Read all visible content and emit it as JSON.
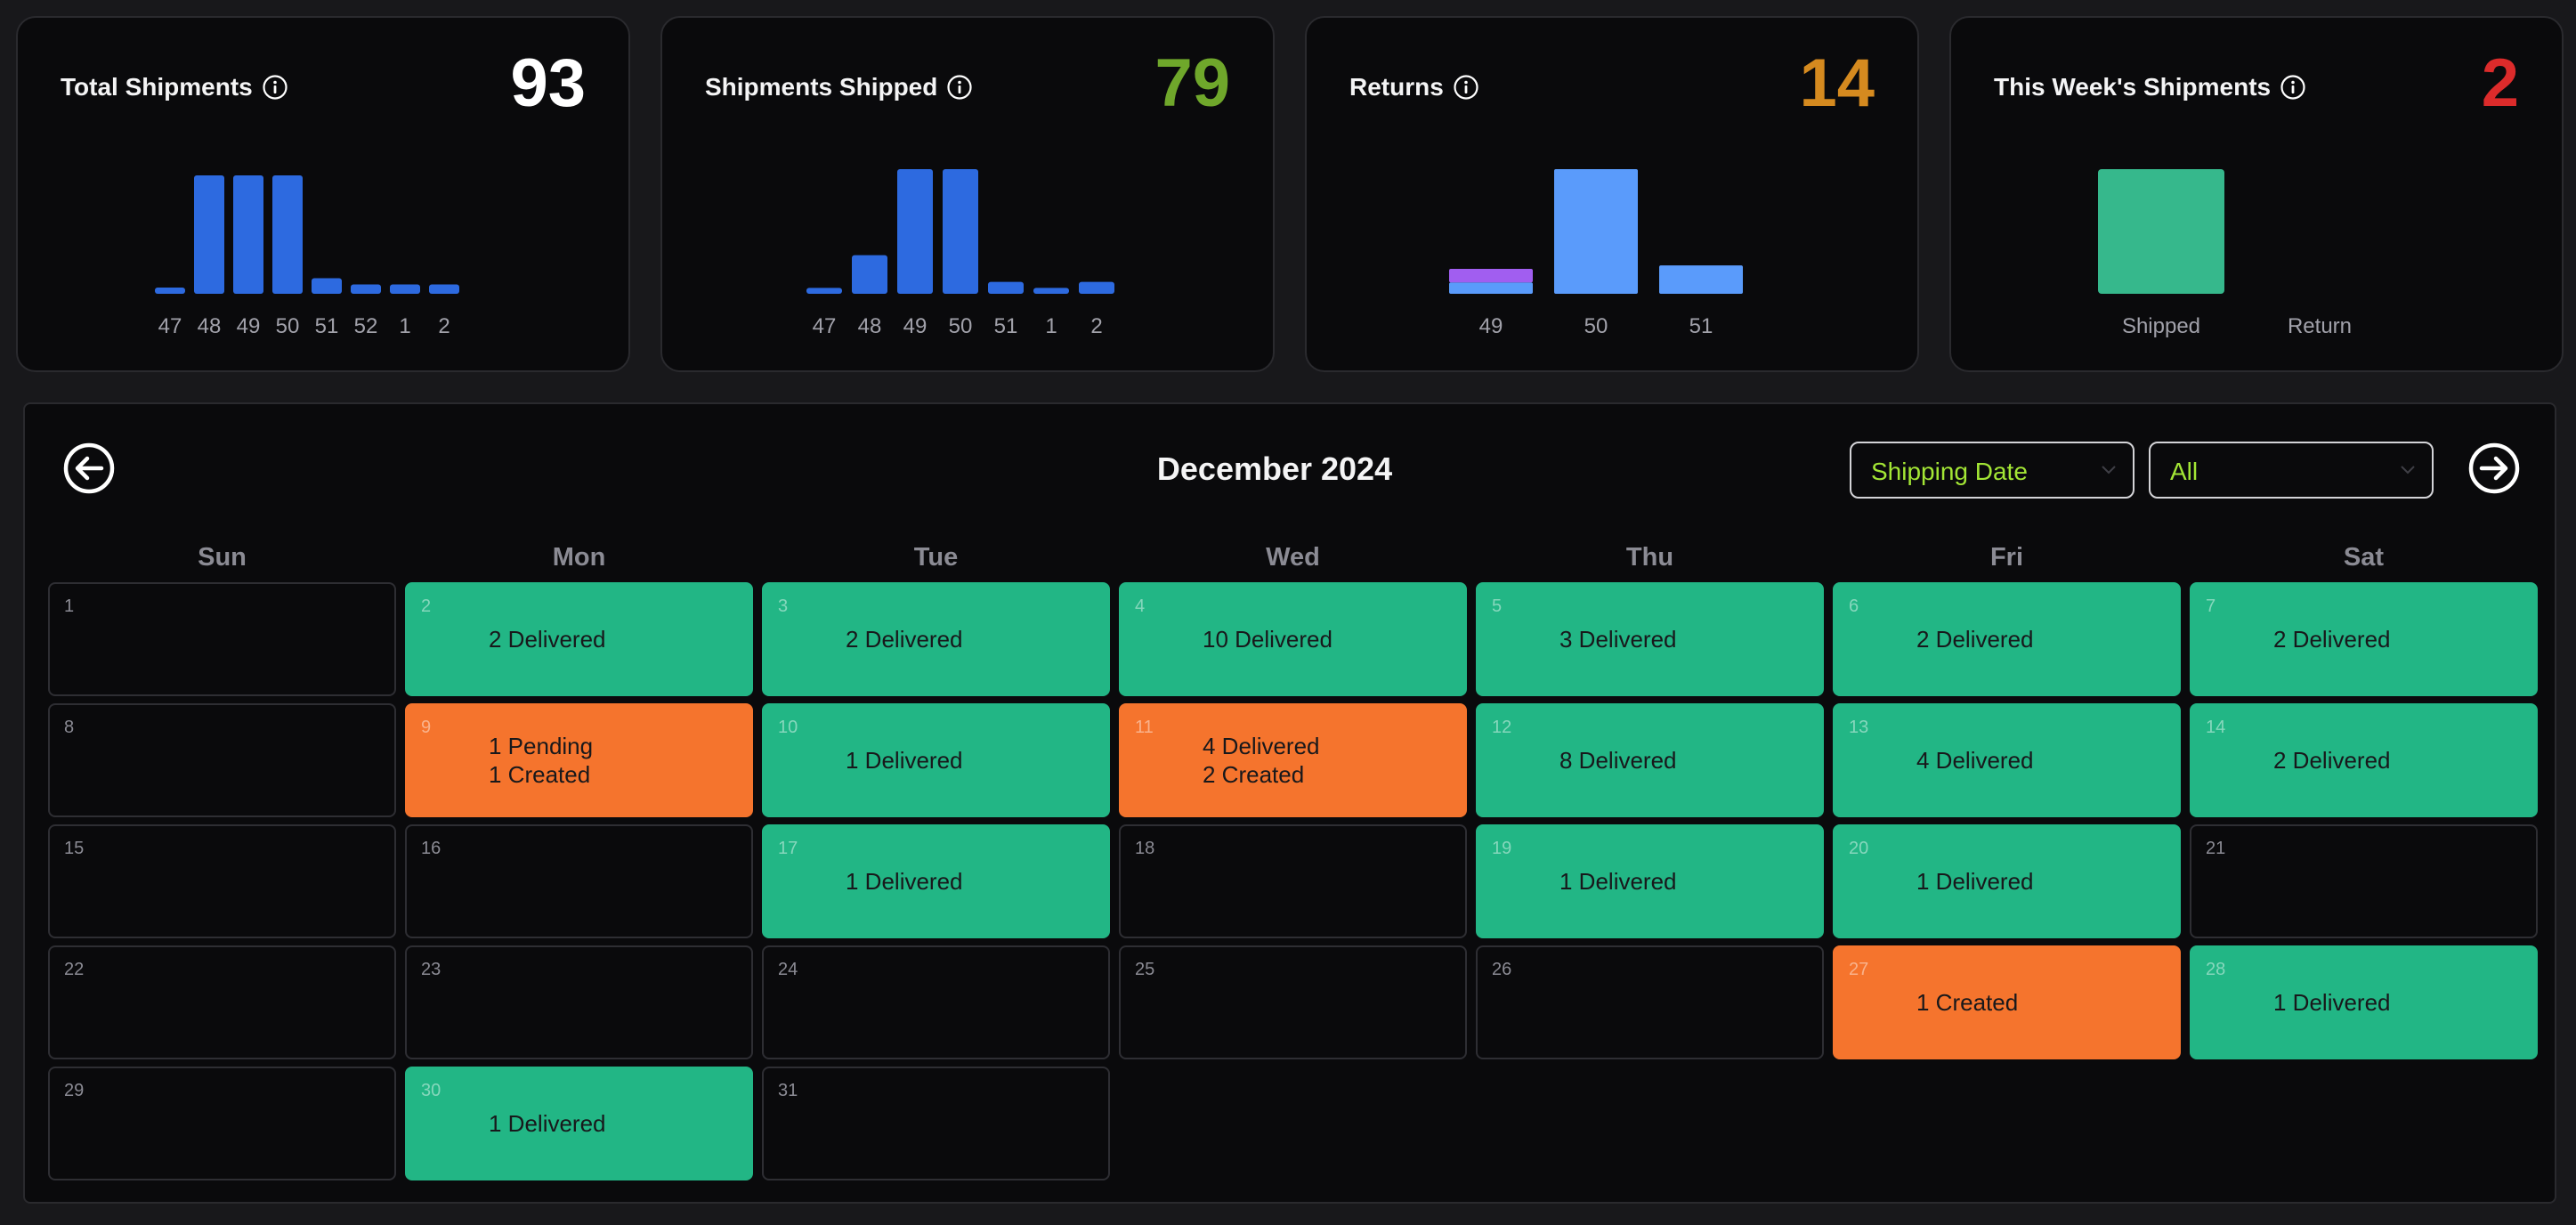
{
  "colors": {
    "bar_blue": "#2d6ae0",
    "bar_light_blue": "#5a9bfb",
    "bar_purple": "#a15ef0",
    "bar_green": "#36b88c",
    "value_white": "#ffffff",
    "value_green": "#6fa72b",
    "value_orange": "#d58a1f",
    "value_red": "#dc2b2b",
    "day_green": "#22b685",
    "day_orange": "#f5742d"
  },
  "cards": [
    {
      "title": "Total Shipments",
      "value": "93",
      "value_color": "#ffffff",
      "icon": "info-icon"
    },
    {
      "title": "Shipments Shipped",
      "value": "79",
      "value_color": "#6fa72b",
      "icon": "info-icon"
    },
    {
      "title": "Returns",
      "value": "14",
      "value_color": "#d58a1f",
      "icon": "info-icon"
    },
    {
      "title": "This Week's Shipments",
      "value": "2",
      "value_color": "#dc2b2b",
      "icon": "info-icon"
    }
  ],
  "chart_data": [
    {
      "type": "bar",
      "categories": [
        "47",
        "48",
        "49",
        "50",
        "51",
        "52",
        "1",
        "2"
      ],
      "values": [
        1,
        19,
        19,
        19,
        2.5,
        1.5,
        1.5,
        1.5
      ],
      "ylim": [
        0,
        20
      ],
      "color": "#2d6ae0"
    },
    {
      "type": "bar",
      "categories": [
        "47",
        "48",
        "49",
        "50",
        "51",
        "1",
        "2"
      ],
      "values": [
        1,
        6.5,
        21,
        21,
        2,
        1,
        2
      ],
      "ylim": [
        0,
        21
      ],
      "color": "#2d6ae0"
    },
    {
      "type": "bar",
      "categories": [
        "49",
        "50",
        "51"
      ],
      "series": [
        {
          "values": [
            1,
            11,
            2.5
          ],
          "color": "#5a9bfb"
        },
        {
          "values": [
            1.2,
            0,
            0
          ],
          "color": "#a15ef0"
        }
      ],
      "ylim": [
        0,
        11
      ],
      "stacked": true
    },
    {
      "type": "bar",
      "categories": [
        "Shipped",
        "Return"
      ],
      "values": [
        2,
        0
      ],
      "ylim": [
        0,
        2
      ],
      "color": "#36b88c"
    }
  ],
  "calendar": {
    "prev_icon": "arrow-left-circle-icon",
    "next_icon": "arrow-right-circle-icon",
    "month_label": "December 2024",
    "filters": {
      "date_type": "Shipping Date",
      "status": "All"
    },
    "weekdays": [
      "Sun",
      "Mon",
      "Tue",
      "Wed",
      "Thu",
      "Fri",
      "Sat"
    ],
    "first_weekday": 0,
    "days": [
      {
        "day": "1",
        "status": "empty",
        "lines": []
      },
      {
        "day": "2",
        "status": "green",
        "lines": [
          "2 Delivered"
        ]
      },
      {
        "day": "3",
        "status": "green",
        "lines": [
          "2 Delivered"
        ]
      },
      {
        "day": "4",
        "status": "green",
        "lines": [
          "10 Delivered"
        ]
      },
      {
        "day": "5",
        "status": "green",
        "lines": [
          "3 Delivered"
        ]
      },
      {
        "day": "6",
        "status": "green",
        "lines": [
          "2 Delivered"
        ]
      },
      {
        "day": "7",
        "status": "green",
        "lines": [
          "2 Delivered"
        ]
      },
      {
        "day": "8",
        "status": "empty",
        "lines": []
      },
      {
        "day": "9",
        "status": "orange",
        "lines": [
          "1 Pending",
          "1 Created"
        ]
      },
      {
        "day": "10",
        "status": "green",
        "lines": [
          "1 Delivered"
        ]
      },
      {
        "day": "11",
        "status": "orange",
        "lines": [
          "4 Delivered",
          "2 Created"
        ]
      },
      {
        "day": "12",
        "status": "green",
        "lines": [
          "8 Delivered"
        ]
      },
      {
        "day": "13",
        "status": "green",
        "lines": [
          "4 Delivered"
        ]
      },
      {
        "day": "14",
        "status": "green",
        "lines": [
          "2 Delivered"
        ]
      },
      {
        "day": "15",
        "status": "empty",
        "lines": []
      },
      {
        "day": "16",
        "status": "empty",
        "lines": []
      },
      {
        "day": "17",
        "status": "green",
        "lines": [
          "1 Delivered"
        ]
      },
      {
        "day": "18",
        "status": "empty",
        "lines": []
      },
      {
        "day": "19",
        "status": "green",
        "lines": [
          "1 Delivered"
        ]
      },
      {
        "day": "20",
        "status": "green",
        "lines": [
          "1 Delivered"
        ]
      },
      {
        "day": "21",
        "status": "empty",
        "lines": []
      },
      {
        "day": "22",
        "status": "empty",
        "lines": []
      },
      {
        "day": "23",
        "status": "empty",
        "lines": []
      },
      {
        "day": "24",
        "status": "empty",
        "lines": []
      },
      {
        "day": "25",
        "status": "empty",
        "lines": []
      },
      {
        "day": "26",
        "status": "empty",
        "lines": []
      },
      {
        "day": "27",
        "status": "orange",
        "lines": [
          "1 Created"
        ]
      },
      {
        "day": "28",
        "status": "green",
        "lines": [
          "1 Delivered"
        ]
      },
      {
        "day": "29",
        "status": "empty",
        "lines": []
      },
      {
        "day": "30",
        "status": "green",
        "lines": [
          "1 Delivered"
        ]
      },
      {
        "day": "31",
        "status": "empty",
        "lines": []
      }
    ]
  }
}
